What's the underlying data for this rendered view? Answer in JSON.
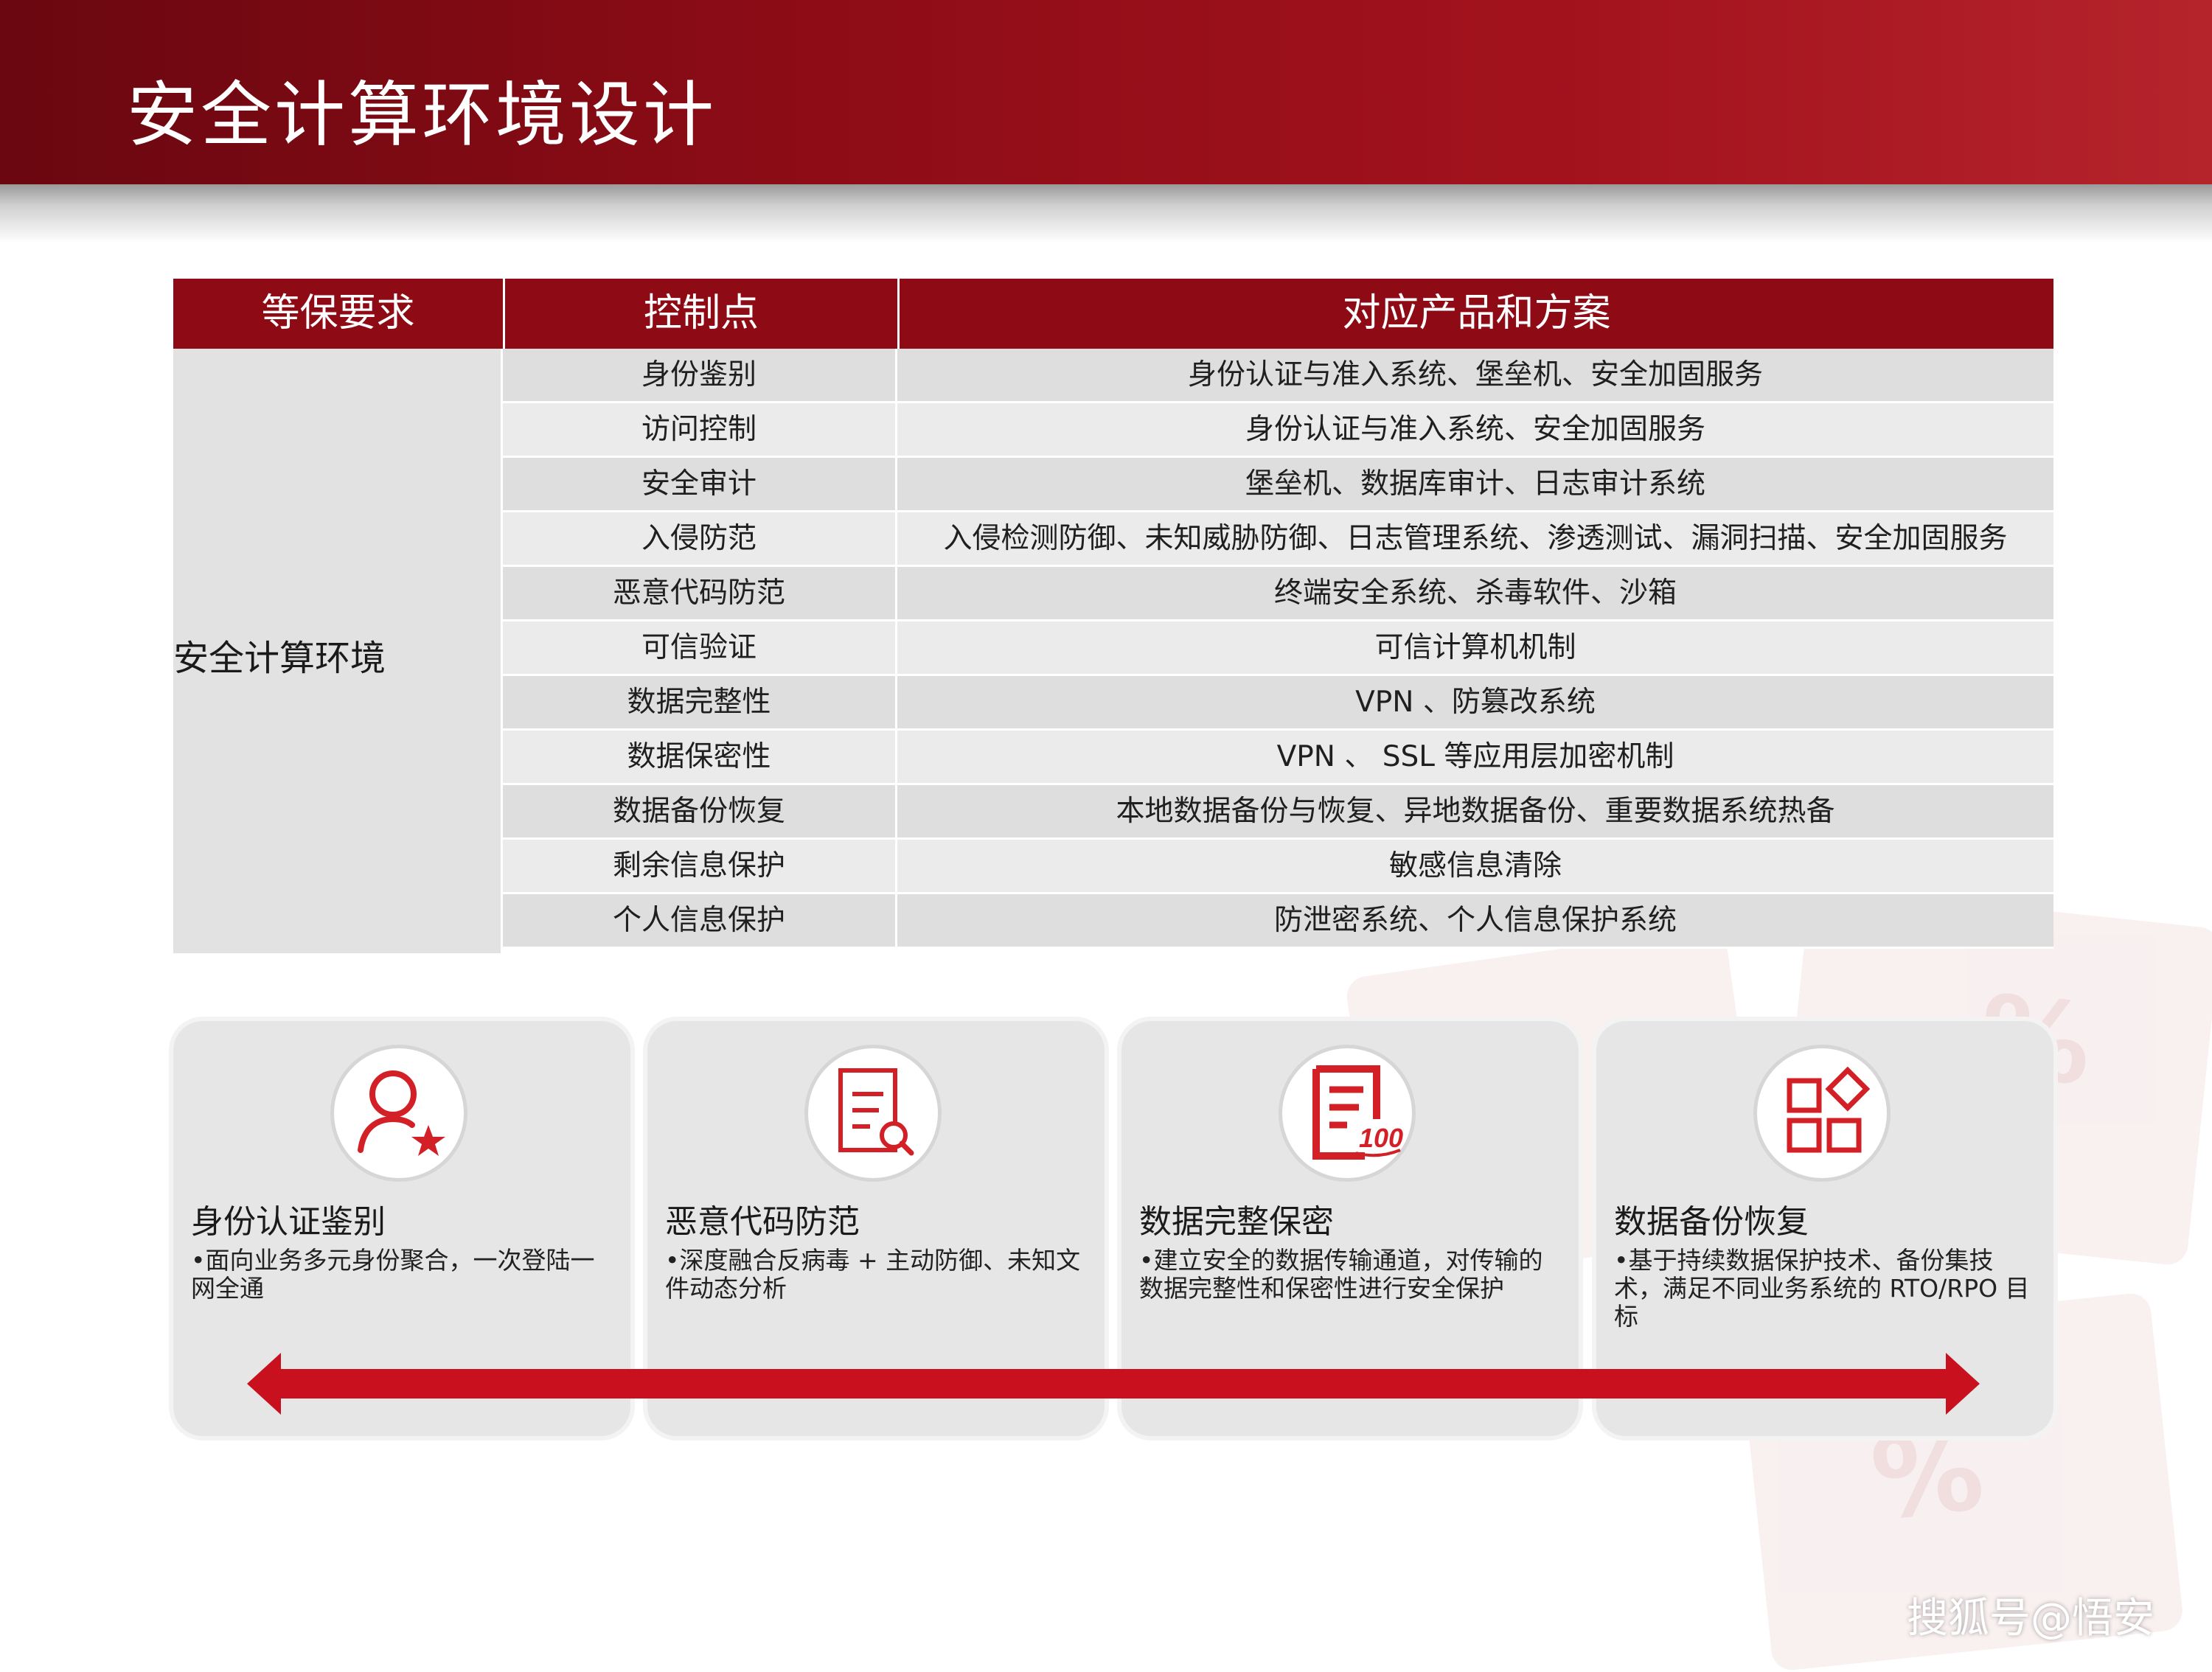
{
  "title": "安全计算环境设计",
  "table": {
    "headers": [
      "等保要求",
      "控制点",
      "对应产品和方案"
    ],
    "group": "安全计算环境",
    "rows": [
      {
        "control": "身份鉴别",
        "product": "身份认证与准入系统、堡垒机、安全加固服务"
      },
      {
        "control": "访问控制",
        "product": "身份认证与准入系统、安全加固服务"
      },
      {
        "control": "安全审计",
        "product": "堡垒机、数据库审计、日志审计系统"
      },
      {
        "control": "入侵防范",
        "product": "入侵检测防御、未知威胁防御、日志管理系统、渗透测试、漏洞扫描、安全加固服务"
      },
      {
        "control": "恶意代码防范",
        "product": "终端安全系统、杀毒软件、沙箱"
      },
      {
        "control": "可信验证",
        "product": "可信计算机机制"
      },
      {
        "control": "数据完整性",
        "product": "VPN 、防篡改系统"
      },
      {
        "control": "数据保密性",
        "product": "VPN 、 SSL 等应用层加密机制"
      },
      {
        "control": "数据备份恢复",
        "product": "本地数据备份与恢复、异地数据备份、重要数据系统热备"
      },
      {
        "control": "剩余信息保护",
        "product": "敏感信息清除"
      },
      {
        "control": "个人信息保护",
        "product": "防泄密系统、个人信息保护系统"
      }
    ]
  },
  "cards": [
    {
      "icon": "user-star-icon",
      "title": "身份认证鉴别",
      "desc": "•面向业务多元身份聚合，一次登陆一网全通"
    },
    {
      "icon": "document-search-icon",
      "title": "恶意代码防范",
      "desc": "•深度融合反病毒 + 主动防御、未知文件动态分析"
    },
    {
      "icon": "document-100-icon",
      "title": "数据完整保密",
      "desc": "•建立安全的数据传输通道，对传输的数据完整性和保密性进行安全保护"
    },
    {
      "icon": "apps-grid-icon",
      "title": "数据备份恢复",
      "desc": "•基于持续数据保护技术、备份集技术，满足不同业务系统的 RTO/RPO 目标"
    }
  ],
  "icon_text_100": "100",
  "watermark": "搜狐号@悟安",
  "colors": {
    "brand_red": "#8e0a14",
    "icon_red": "#d31f26",
    "arrow_red": "#c8101e"
  }
}
